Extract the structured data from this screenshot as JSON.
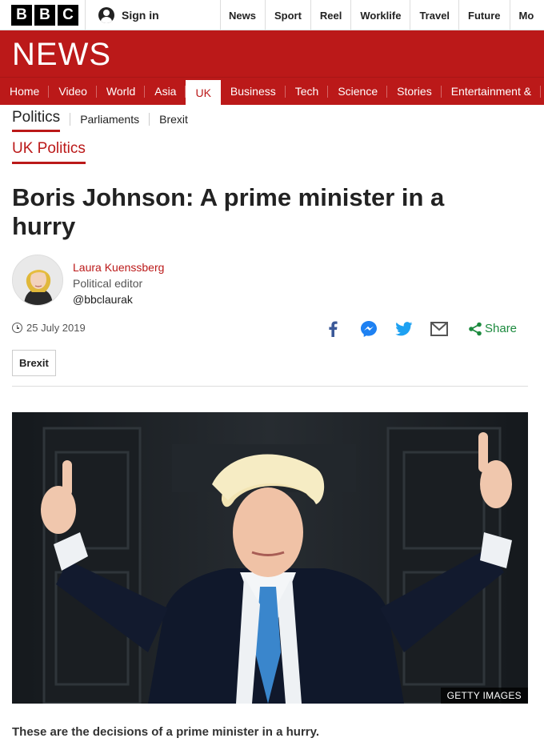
{
  "brand": {
    "letters": [
      "B",
      "B",
      "C"
    ]
  },
  "header": {
    "signin_label": "Sign in",
    "top_nav": [
      "News",
      "Sport",
      "Reel",
      "Worklife",
      "Travel",
      "Future",
      "Mo"
    ]
  },
  "banner": {
    "title": "NEWS",
    "color": "#bb1919"
  },
  "main_nav": {
    "items": [
      "Home",
      "Video",
      "World",
      "Asia",
      "UK",
      "Business",
      "Tech",
      "Science",
      "Stories",
      "Entertainment &"
    ],
    "active": "UK"
  },
  "sub_nav": {
    "current": "Politics",
    "items": [
      "Parliaments",
      "Brexit"
    ]
  },
  "section": {
    "title": "UK Politics"
  },
  "article": {
    "headline": "Boris Johnson: A prime minister in a hurry",
    "author": {
      "name": "Laura Kuenssberg",
      "role": "Political editor",
      "handle": "@bbclaurak"
    },
    "date": "25 July 2019",
    "share": {
      "label": "Share",
      "icons": [
        "facebook-icon",
        "messenger-icon",
        "twitter-icon",
        "email-icon",
        "share-icon"
      ]
    },
    "tag": "Brexit",
    "image_credit": "GETTY IMAGES",
    "intro": "These are the decisions of a prime minister in a hurry."
  }
}
